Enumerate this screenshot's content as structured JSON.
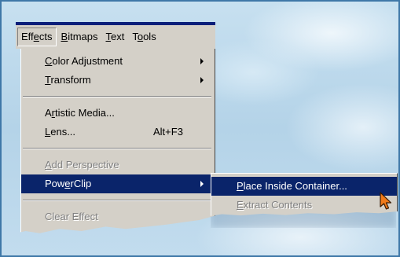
{
  "menubar": {
    "items": [
      {
        "label": "Effects",
        "mnemonic_index": 3,
        "active": true
      },
      {
        "label": "Bitmaps",
        "mnemonic_index": 0
      },
      {
        "label": "Text",
        "mnemonic_index": 0
      },
      {
        "label": "Tools",
        "mnemonic_index": 1
      }
    ]
  },
  "effects_menu": {
    "items": [
      {
        "label": "Color Adjustment",
        "mnemonic_index": 0,
        "submenu": true
      },
      {
        "label": "Transform",
        "mnemonic_index": 0,
        "submenu": true
      },
      {
        "label": "Artistic Media...",
        "mnemonic_index": 1
      },
      {
        "label": "Lens...",
        "mnemonic_index": 0,
        "shortcut": "Alt+F3"
      },
      {
        "label": "Add Perspective",
        "mnemonic_index": 0,
        "disabled": true
      },
      {
        "label": "PowerClip",
        "mnemonic_index": 3,
        "submenu": true,
        "selected": true
      },
      {
        "label": "Clear Effect",
        "disabled": true
      }
    ]
  },
  "powerclip_submenu": {
    "items": [
      {
        "label": "Place Inside Container...",
        "mnemonic_index": 0,
        "selected": true
      },
      {
        "label": "Extract Contents",
        "mnemonic_index": 0,
        "disabled": true
      }
    ]
  },
  "colors": {
    "highlight": "#0a246a",
    "menu_face": "#d4d0c8",
    "frame_border": "#3f78a8"
  }
}
